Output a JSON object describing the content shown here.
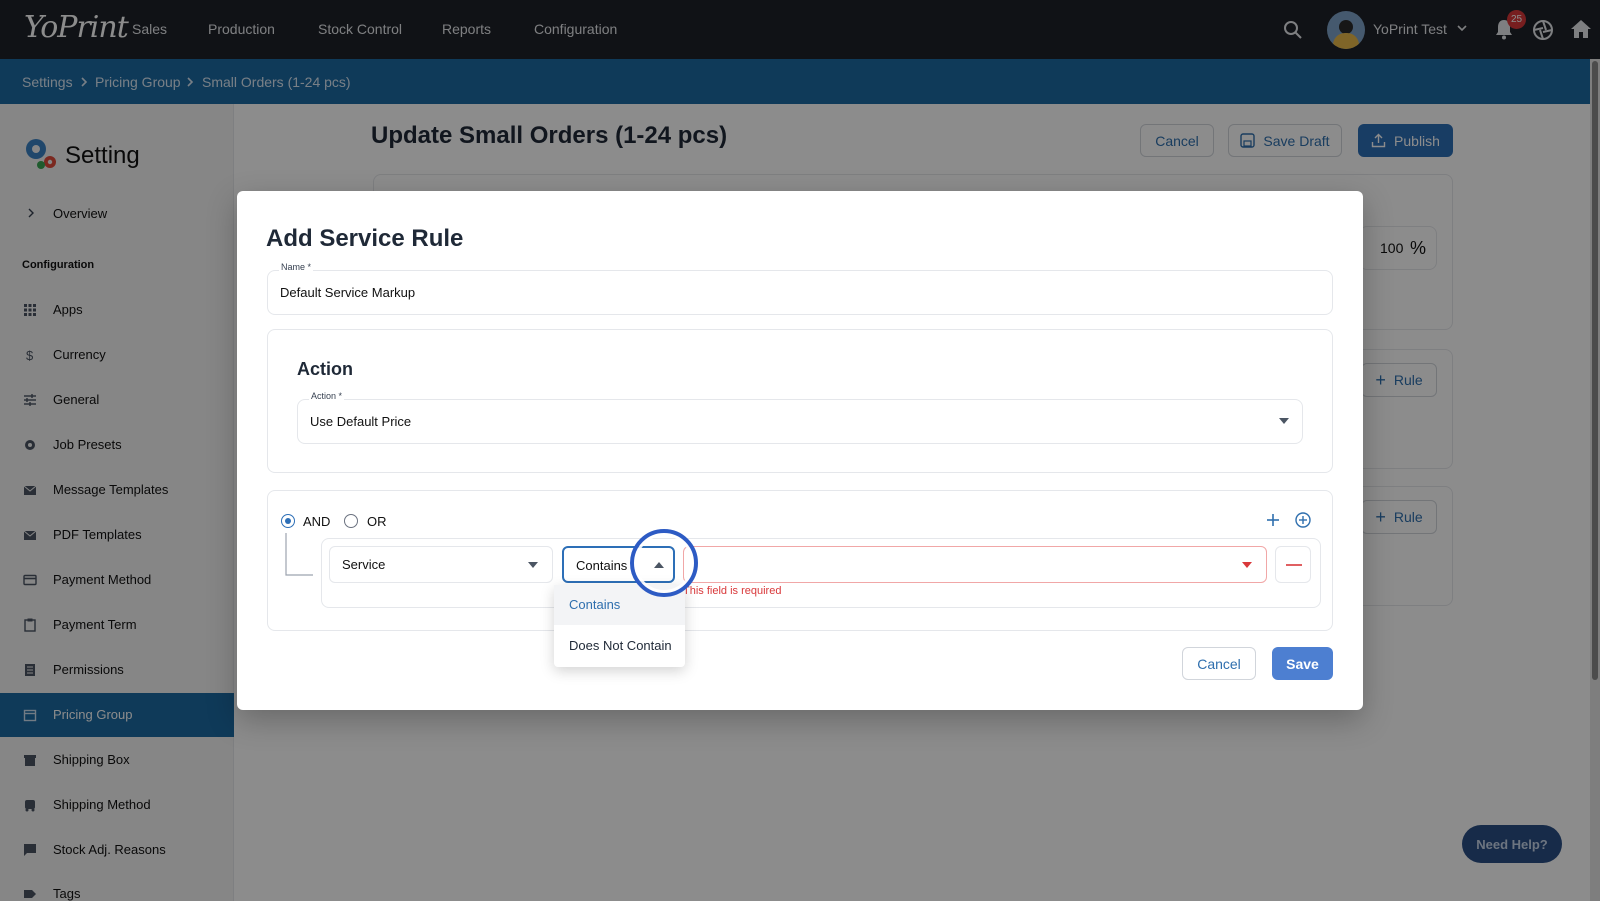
{
  "app": {
    "logo_text": "YoPrint"
  },
  "topnav": {
    "items": [
      "Sales",
      "Production",
      "Stock Control",
      "Reports",
      "Configuration"
    ],
    "user_name": "YoPrint Test",
    "notification_count": "25"
  },
  "breadcrumb": [
    "Settings",
    "Pricing Group",
    "Small Orders (1-24 pcs)"
  ],
  "sidebar": {
    "title": "Setting",
    "overview": "Overview",
    "section_label": "Configuration",
    "items": [
      {
        "label": "Apps",
        "icon": "grid-icon"
      },
      {
        "label": "Currency",
        "icon": "dollar-icon"
      },
      {
        "label": "General",
        "icon": "sliders-icon"
      },
      {
        "label": "Job Presets",
        "icon": "gear-icon"
      },
      {
        "label": "Message Templates",
        "icon": "mail-icon"
      },
      {
        "label": "PDF Templates",
        "icon": "mail-icon"
      },
      {
        "label": "Payment Method",
        "icon": "card-icon"
      },
      {
        "label": "Payment Term",
        "icon": "clipboard-icon"
      },
      {
        "label": "Permissions",
        "icon": "lock-list-icon"
      },
      {
        "label": "Pricing Group",
        "icon": "calendar-icon",
        "active": true
      },
      {
        "label": "Shipping Box",
        "icon": "box-icon"
      },
      {
        "label": "Shipping Method",
        "icon": "truck-icon"
      },
      {
        "label": "Stock Adj. Reasons",
        "icon": "flag-icon"
      },
      {
        "label": "Tags",
        "icon": "tag-icon"
      }
    ]
  },
  "page": {
    "title": "Update Small Orders (1-24 pcs)",
    "cancel_label": "Cancel",
    "save_draft_label": "Save Draft",
    "publish_label": "Publish",
    "percent_value": "100",
    "percent_symbol": "%",
    "rule_label": "Rule"
  },
  "modal": {
    "title": "Add Service Rule",
    "name_label": "Name *",
    "name_value": "Default Service Markup",
    "action_heading": "Action",
    "action_label": "Action *",
    "action_value": "Use Default Price",
    "logic": {
      "and_label": "AND",
      "or_label": "OR",
      "selected": "AND"
    },
    "condition": {
      "field_value": "Service",
      "operator_value": "Contains",
      "error": "This field is required"
    },
    "operator_options": [
      "Contains",
      "Does Not Contain"
    ],
    "cancel_label": "Cancel",
    "save_label": "Save"
  },
  "help": {
    "label": "Need Help?"
  },
  "colors": {
    "nav_bg": "#1e2228",
    "breadcrumb_bg": "#1c6aa3",
    "primary": "#2d6fb7",
    "error": "#d9383a"
  }
}
